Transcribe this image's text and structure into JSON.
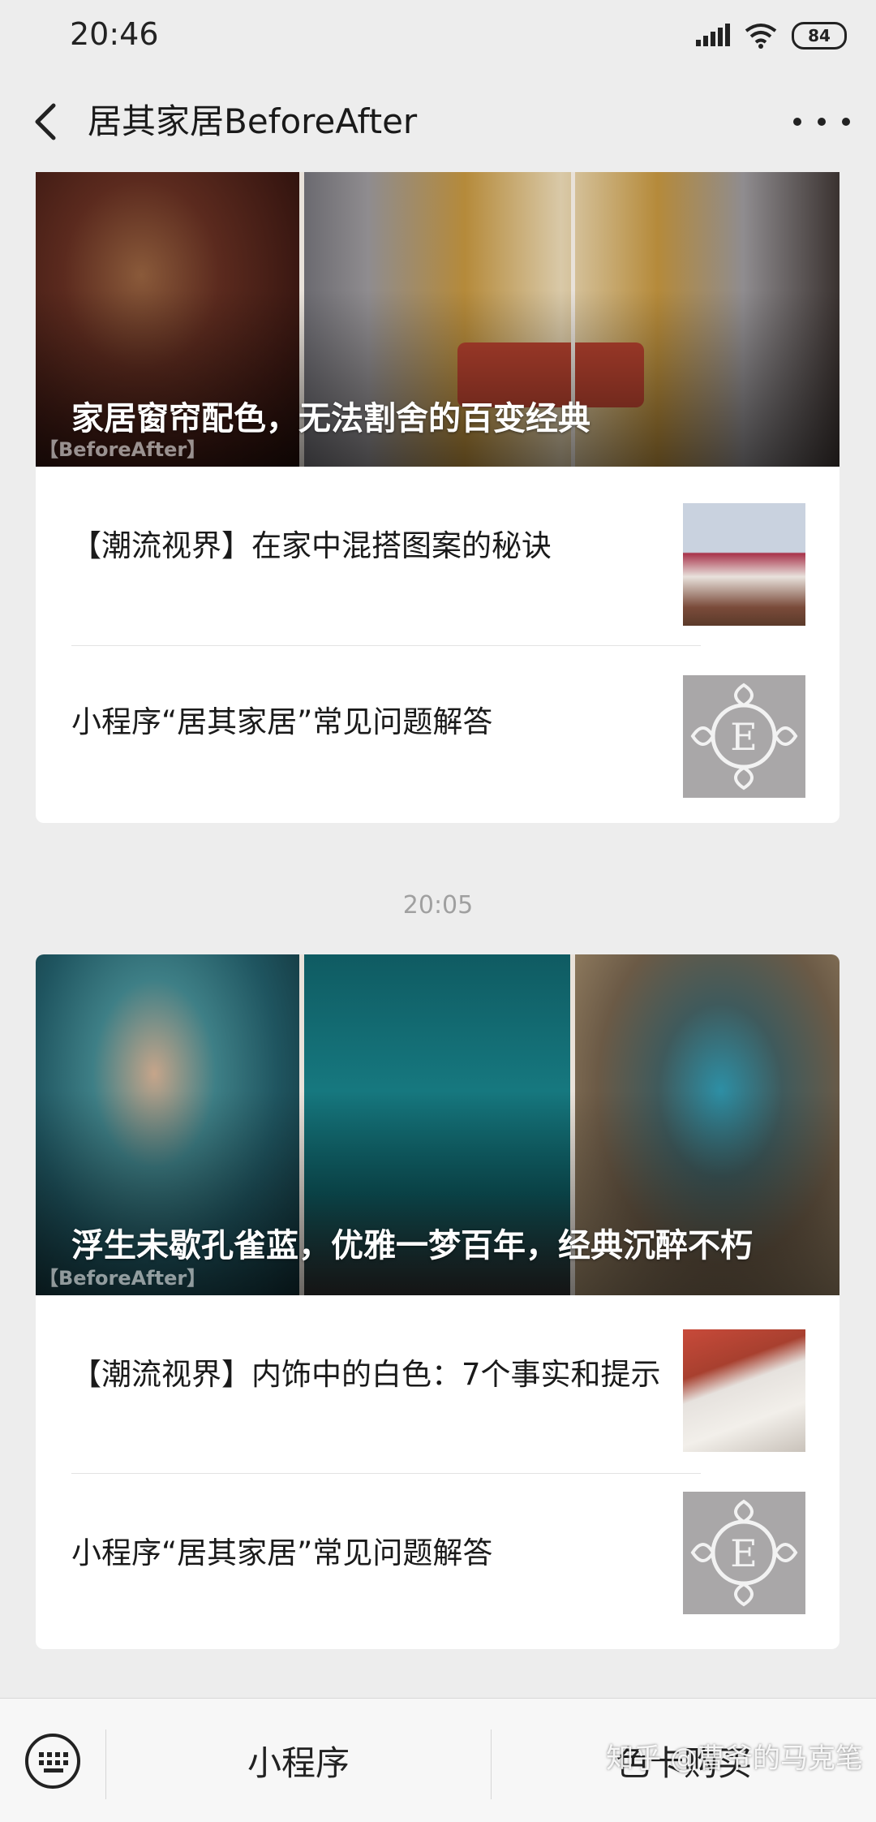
{
  "status_bar": {
    "time": "20:46",
    "battery": "84"
  },
  "nav": {
    "title": "居其家居BeforeAfter"
  },
  "articles": [
    {
      "cover_title": "家居窗帘配色，无法割舍的百变经典",
      "cover_watermark": "【BeforeAfter】",
      "items": [
        {
          "title": "【潮流视界】在家中混搭图案的秘诀"
        },
        {
          "title": "小程序“居其家居”常见问题解答"
        }
      ]
    },
    {
      "timestamp": "20:05",
      "cover_title": "浮生未歇孔雀蓝，优雅一梦百年，经典沉醉不朽",
      "cover_watermark": "【BeforeAfter】",
      "items": [
        {
          "title": "【潮流视界】内饰中的白色：7个事实和提示"
        },
        {
          "title": "小程序“居其家居”常见问题解答"
        }
      ]
    }
  ],
  "bottom_menu": {
    "items": [
      "小程序",
      "色卡购买"
    ],
    "watermark": "知乎 @曹爷的马克笔"
  },
  "colors": {
    "background": "#ededed",
    "card": "#ffffff",
    "peacock": "#1d7f86"
  }
}
